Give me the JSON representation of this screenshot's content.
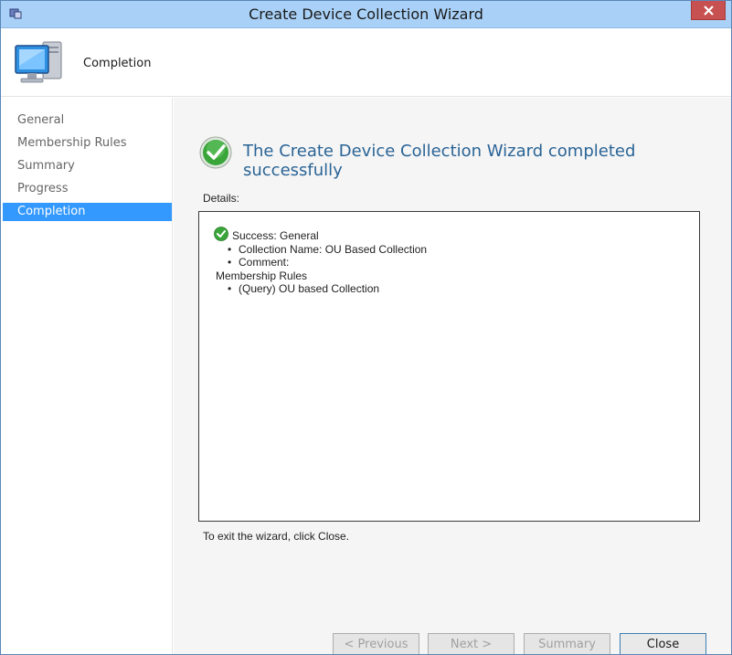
{
  "window": {
    "title": "Create Device Collection Wizard"
  },
  "header": {
    "page_title": "Completion"
  },
  "nav": {
    "items": [
      {
        "label": "General"
      },
      {
        "label": "Membership Rules"
      },
      {
        "label": "Summary"
      },
      {
        "label": "Progress"
      },
      {
        "label": "Completion",
        "active": true
      }
    ]
  },
  "content": {
    "heading": "The Create Device Collection Wizard completed successfully",
    "details_label": "Details:",
    "details": {
      "success_line": "Success: General",
      "general_bullets": [
        "Collection Name: OU Based Collection",
        "Comment:"
      ],
      "membership_heading": "Membership Rules",
      "membership_bullets": [
        "(Query) OU based Collection"
      ]
    },
    "exit_text": "To exit the wizard, click Close."
  },
  "buttons": {
    "previous": "< Previous",
    "next": "Next >",
    "summary": "Summary",
    "close": "Close"
  },
  "colors": {
    "title_bar": "#a9d1f7",
    "active_nav": "#3399ff",
    "heading": "#2a6496",
    "success_green": "#3aa63a"
  }
}
